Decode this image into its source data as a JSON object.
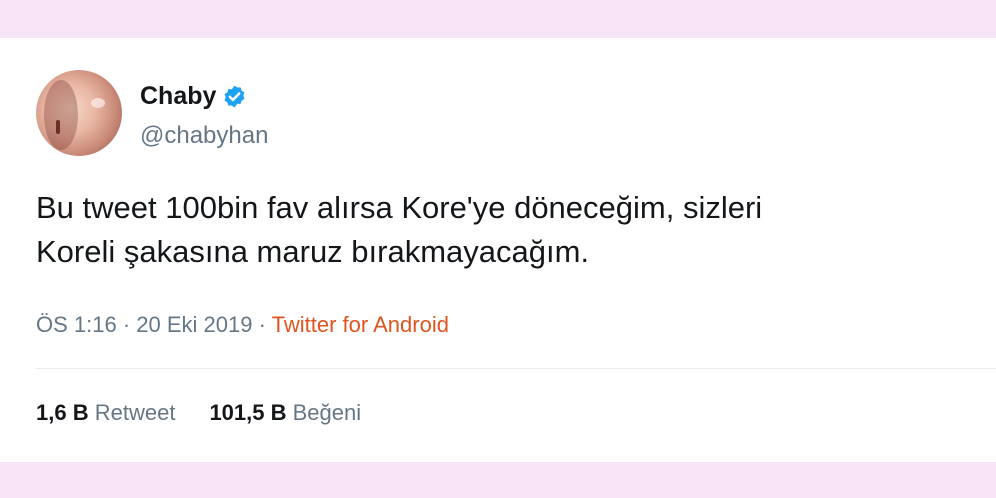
{
  "tweet": {
    "display_name": "Chaby",
    "handle": "@chabyhan",
    "verified_icon": "verified-badge-icon",
    "text_line1": "Bu tweet 100bin fav alırsa Kore'ye döneceğim, sizleri",
    "text_line2": "Koreli şakasına maruz bırakmayacağım.",
    "time": "ÖS 1:16",
    "sep1": " · ",
    "date": "20 Eki 2019",
    "sep2": " · ",
    "source": "Twitter for Android"
  },
  "stats": {
    "retweets_count": "1,6 B",
    "retweets_label": "Retweet",
    "likes_count": "101,5 B",
    "likes_label": "Beğeni"
  },
  "colors": {
    "background": "#f9e4f7",
    "verified": "#1da1f2",
    "source": "#e0541f",
    "secondary_text": "#657786"
  }
}
